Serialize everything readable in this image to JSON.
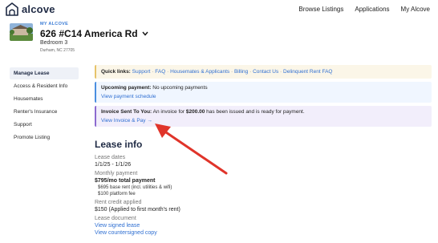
{
  "header": {
    "brand": "alcove",
    "nav": [
      "Browse Listings",
      "Applications",
      "My Alcove"
    ]
  },
  "property": {
    "eyebrow": "MY ALCOVE",
    "title": "626 #C14 America Rd",
    "subtitle": "Bedroom 3",
    "address": "Durham, NC 27705"
  },
  "sidebar": {
    "items": [
      {
        "label": "Manage Lease",
        "active": true
      },
      {
        "label": "Access & Resident Info"
      },
      {
        "label": "Housemates"
      },
      {
        "label": "Renter's Insurance"
      },
      {
        "label": "Support"
      },
      {
        "label": "Promote Listing"
      }
    ]
  },
  "quick_links": {
    "title": "Quick links:",
    "links": [
      "Support",
      "FAQ",
      "Housemates & Applicants",
      "Billing",
      "Contact Us",
      "Delinquent Rent FAQ"
    ]
  },
  "upcoming": {
    "label": "Upcoming payment:",
    "text": "No upcoming payments",
    "link": "View payment schedule"
  },
  "invoice": {
    "label": "Invoice Sent To You:",
    "text_before": "An invoice for",
    "amount": "$200.00",
    "text_after": "has been issued and is ready for payment.",
    "link": "View Invoice & Pay →"
  },
  "lease_info": {
    "title": "Lease info",
    "dates_label": "Lease dates",
    "dates_value": "1/1/25 - 1/1/26",
    "payment_label": "Monthly payment",
    "payment_value": "$795/mo total payment",
    "payment_detail1": "$695 base rent (incl. utilities & wifi)",
    "payment_detail2": "$100 platform fee",
    "credit_label": "Rent credit applied",
    "credit_value": "$150 (Applied to first month's rent)",
    "document_label": "Lease document",
    "doc_link1": "View signed lease",
    "doc_link2": "View countersigned copy"
  },
  "colors": {
    "brand": "#1f2a44",
    "link": "#2f6fd2",
    "annotation_arrow": "#e0342a"
  }
}
